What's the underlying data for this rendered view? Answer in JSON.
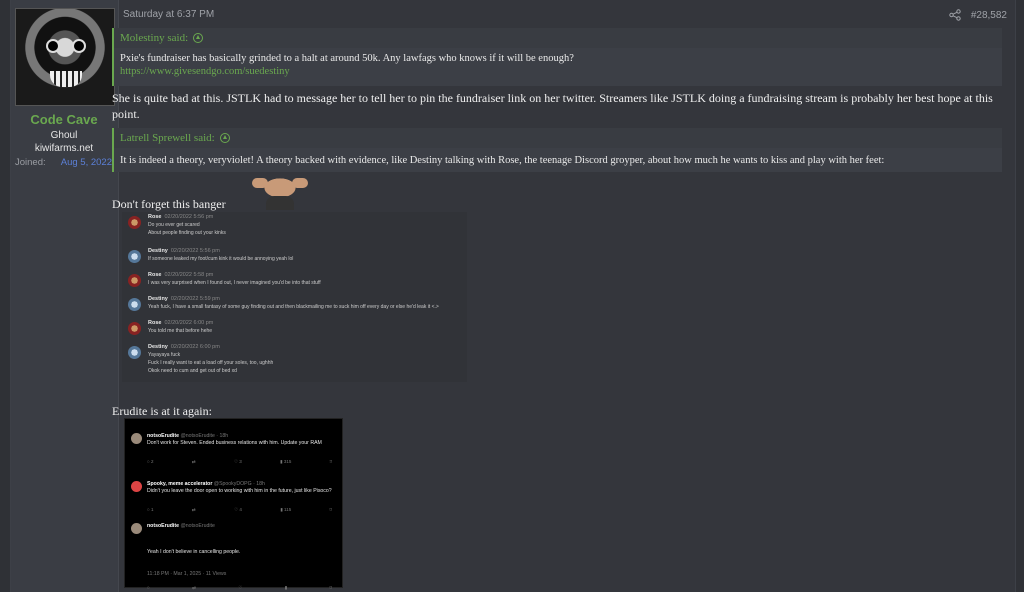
{
  "user": {
    "name": "Code Cave",
    "title": "Ghoul",
    "banner": "kiwifarms.net",
    "joined_label": "Joined:",
    "joined_value": "Aug 5, 2022"
  },
  "post": {
    "date": "Saturday at 6:37 PM",
    "number": "#28,582"
  },
  "quote1": {
    "author": "Molestiny said:",
    "text": "Pxie's fundraiser has basically grinded to a halt at around 50k. Any lawfags who knows if it will be enough?",
    "link": "https://www.givesendgo.com/suedestiny"
  },
  "paragraph1": "She is quite bad at this. JSTLK had to message her to tell her to pin the fundraiser link on her twitter. Streamers like JSTLK doing a fundraising stream is probably her best hope at this point.",
  "quote2": {
    "author": "Latrell Sprewell said:",
    "text": "It is indeed a theory, veryviolet! A theory backed with evidence, like Destiny talking with Rose, the teenage Discord groyper, about how much he wants to kiss and play with her feet:"
  },
  "banger_text": "Don't forget this banger",
  "discord": [
    {
      "name": "Rose",
      "time": "02/20/2022 5:56 pm",
      "lines": [
        "Do you ever get scared",
        "About people finding out your kinks"
      ]
    },
    {
      "name": "Destiny",
      "time": "02/20/2022 5:56 pm",
      "lines": [
        "If someone leaked my foot/cum kink it would be annoying yeah lol"
      ]
    },
    {
      "name": "Rose",
      "time": "02/20/2022 5:58 pm",
      "lines": [
        "I was very surprised when I found out, I never imagined you'd be into that stuff"
      ]
    },
    {
      "name": "Destiny",
      "time": "02/20/2022 5:59 pm",
      "lines": [
        "Yeah fuck, I have a small fantasy of some guy finding out and then blackmailing me to suck him off every day or else he'd leak it <.>"
      ]
    },
    {
      "name": "Rose",
      "time": "02/20/2022 6:00 pm",
      "lines": [
        "You told me that before hehe"
      ]
    },
    {
      "name": "Destiny",
      "time": "02/20/2022 6:00 pm",
      "lines": [
        "Yayayaya fuck",
        "Fuck I really want to eat a load off your soles, too, ughhh",
        "Okok need to cum and get out of bed xd"
      ]
    }
  ],
  "erudite_text": "Erudite is at it again:",
  "tweets": [
    {
      "name": "notsoErudite",
      "handle": "@notsoErudite · 18h",
      "text": "Don't work for Steven. Ended business relations with him. Update your RAM",
      "actions": [
        "2",
        "",
        "3",
        "315",
        ""
      ]
    },
    {
      "name": "Spooky, meme accelerator",
      "handle": "@SpookyDOPG · 18h",
      "text": "Didn't you leave the door open to working with him in the future, just like Pisoco?",
      "actions": [
        "1",
        "",
        "4",
        "115",
        ""
      ]
    },
    {
      "name": "notsoErudite",
      "handle": "@notsoErudite",
      "text": "Yeah I don't believe in cancelling people.",
      "footer": "11:18 PM · Mar 1, 2025 · 11 Views"
    }
  ],
  "colors": {
    "accent_green": "#6aa84f",
    "link_blue": "#5b7fd6",
    "background": "#34363c"
  }
}
